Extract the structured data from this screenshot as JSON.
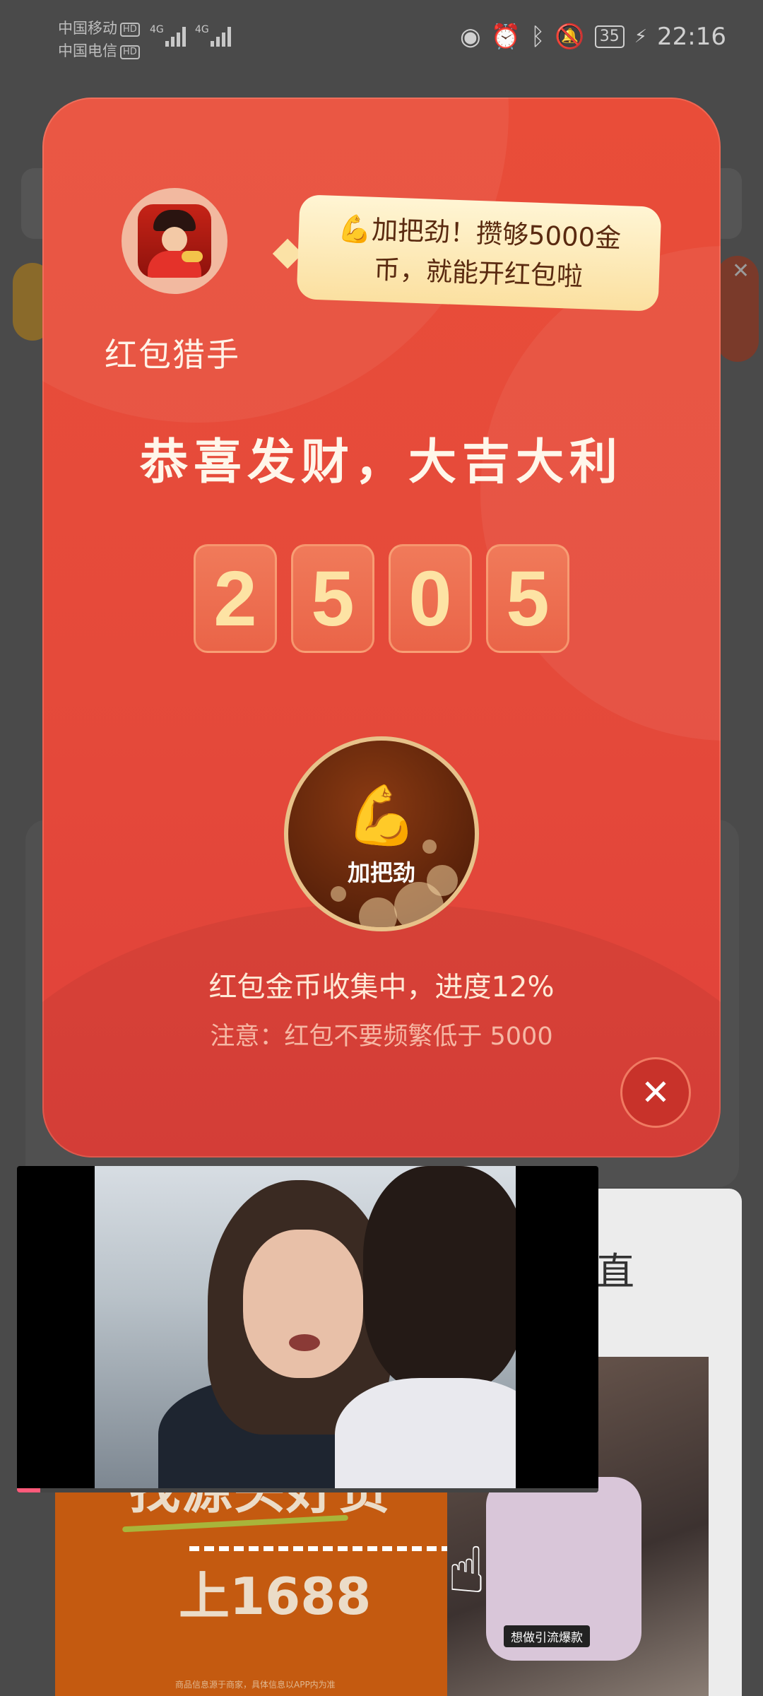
{
  "status_bar": {
    "carrier1": "中国移动",
    "carrier2": "中国电信",
    "hd": "HD",
    "net1": "4G",
    "net2": "4G",
    "battery": "35",
    "time": "22:16",
    "icons": [
      "eye-icon",
      "alarm-icon",
      "bluetooth-icon",
      "mute-icon",
      "battery-icon",
      "charging-icon"
    ]
  },
  "background": {
    "panel_char": "直",
    "ad": {
      "line1": "找源头好货",
      "line2": "上1688",
      "tag": "想做引流爆款",
      "fine_print": "商品信息源于商家，具体信息以APP内为准"
    }
  },
  "modal": {
    "hunter_label": "红包猎手",
    "bubble_emoji": "💪",
    "bubble_text": "加把劲！攒够5000金币，就能开红包啦",
    "congrats": "恭喜发财，大吉大利",
    "digits": [
      "2",
      "5",
      "0",
      "5"
    ],
    "button_emoji": "💪",
    "button_label": "加把劲",
    "progress_text": "红包金币收集中，进度12%",
    "progress_percent": 12,
    "notice_text": "注意：红包不要频繁低于 5000",
    "close_symbol": "✕"
  },
  "video": {
    "progress_fraction": 0.04
  },
  "colors": {
    "modal_red": "#e94d39",
    "digit_gold": "#fde3a4",
    "button_brown": "#5a220a",
    "video_progress": "#ff5a7a"
  }
}
